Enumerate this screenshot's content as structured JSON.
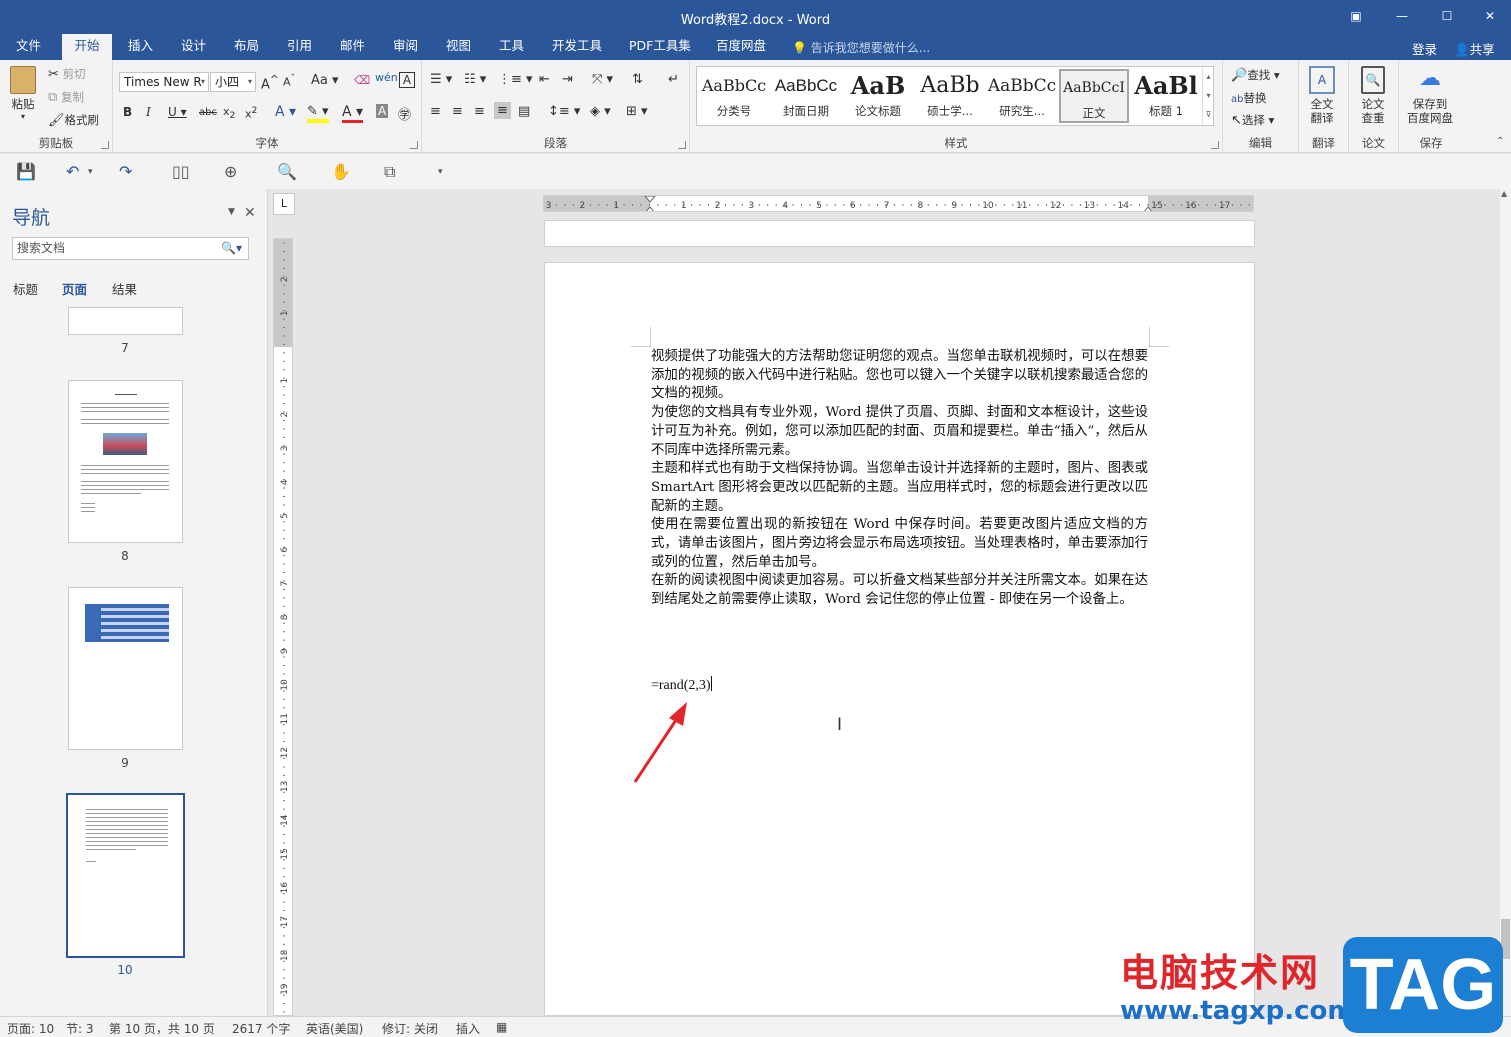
{
  "window": {
    "title": "Word教程2.docx - Word",
    "restore_icon": "ribbon-display-icon",
    "minimize": "—",
    "maximize": "☐",
    "close": "✕"
  },
  "tabs": [
    "文件",
    "开始",
    "插入",
    "设计",
    "布局",
    "引用",
    "邮件",
    "审阅",
    "视图",
    "工具",
    "开发工具",
    "PDF工具集",
    "百度网盘"
  ],
  "active_tab": "开始",
  "tellme": "告诉我您想要做什么...",
  "login": "登录",
  "share": "共享",
  "clipboard": {
    "paste": "粘贴",
    "cut": "剪切",
    "copy": "复制",
    "format_painter": "格式刷",
    "label": "剪贴板"
  },
  "font": {
    "name": "Times New R",
    "size": "小四",
    "label": "字体"
  },
  "paragraph": {
    "label": "段落"
  },
  "styles": {
    "label": "样式",
    "items": [
      {
        "preview": "AaBbCc",
        "name": "分类号"
      },
      {
        "preview": "AaBbCc",
        "name": "封面日期"
      },
      {
        "preview": "AaB",
        "name": "论文标题"
      },
      {
        "preview": "AaBb",
        "name": "硕士学..."
      },
      {
        "preview": "AaBbCc",
        "name": "研究生..."
      },
      {
        "preview": "AaBbCcI",
        "name": "正文"
      },
      {
        "preview": "AaBl",
        "name": "标题 1"
      }
    ]
  },
  "editing": {
    "find": "查找",
    "replace": "替换",
    "select": "选择",
    "label": "编辑"
  },
  "translate": {
    "btn": "全文\n翻译",
    "label": "翻译"
  },
  "paper": {
    "btn": "论文\n查重",
    "label": "论文"
  },
  "save": {
    "btn": "保存到\n百度网盘",
    "label": "保存"
  },
  "nav": {
    "title": "导航",
    "search_placeholder": "搜索文档",
    "tabs": [
      "标题",
      "页面",
      "结果"
    ],
    "active_tab": "页面",
    "pages": [
      "7",
      "8",
      "9",
      "10"
    ],
    "current_page": "10"
  },
  "ruler": {
    "corner": "L",
    "h_numbers": [
      "3",
      "2",
      "1",
      "1",
      "2",
      "3",
      "4",
      "5",
      "6",
      "7",
      "8",
      "9",
      "10",
      "11",
      "12",
      "13",
      "14",
      "15",
      "16",
      "17"
    ],
    "v_numbers": [
      "2",
      "1",
      "1",
      "2",
      "3",
      "4",
      "5",
      "6",
      "7",
      "8",
      "9",
      "10",
      "11",
      "12",
      "13",
      "14",
      "15",
      "16",
      "17",
      "18",
      "19"
    ]
  },
  "document": {
    "paragraphs": [
      "视频提供了功能强大的方法帮助您证明您的观点。当您单击联机视频时，可以在想要添加的视频的嵌入代码中进行粘贴。您也可以键入一个关键字以联机搜索最适合您的文档的视频。",
      "为使您的文档具有专业外观，Word 提供了页眉、页脚、封面和文本框设计，这些设计可互为补充。例如，您可以添加匹配的封面、页眉和提要栏。单击“插入”，然后从不同库中选择所需元素。",
      "主题和样式也有助于文档保持协调。当您单击设计并选择新的主题时，图片、图表或 SmartArt 图形将会更改以匹配新的主题。当应用样式时，您的标题会进行更改以匹配新的主题。",
      "使用在需要位置出现的新按钮在 Word 中保存时间。若要更改图片适应文档的方式，请单击该图片，图片旁边将会显示布局选项按钮。当处理表格时，单击要添加行或列的位置，然后单击加号。",
      "在新的阅读视图中阅读更加容易。可以折叠文档某些部分并关注所需文本。如果在达到结尾处之前需要停止读取，Word 会记住您的停止位置 - 即使在另一个设备上。"
    ],
    "formula": "=rand(2,3)"
  },
  "status": {
    "page": "页面: 10",
    "section": "节: 3",
    "pages": "第 10 页，共 10 页",
    "words": "2617 个字",
    "lang": "英语(美国)",
    "track": "修订: 关闭",
    "mode": "插入"
  },
  "watermark": {
    "site_cn": "电脑技术网",
    "url": "www.tagxp.com",
    "logo": "TAG"
  },
  "colors": {
    "accent": "#2b579a",
    "arrow": "#e0262b"
  }
}
